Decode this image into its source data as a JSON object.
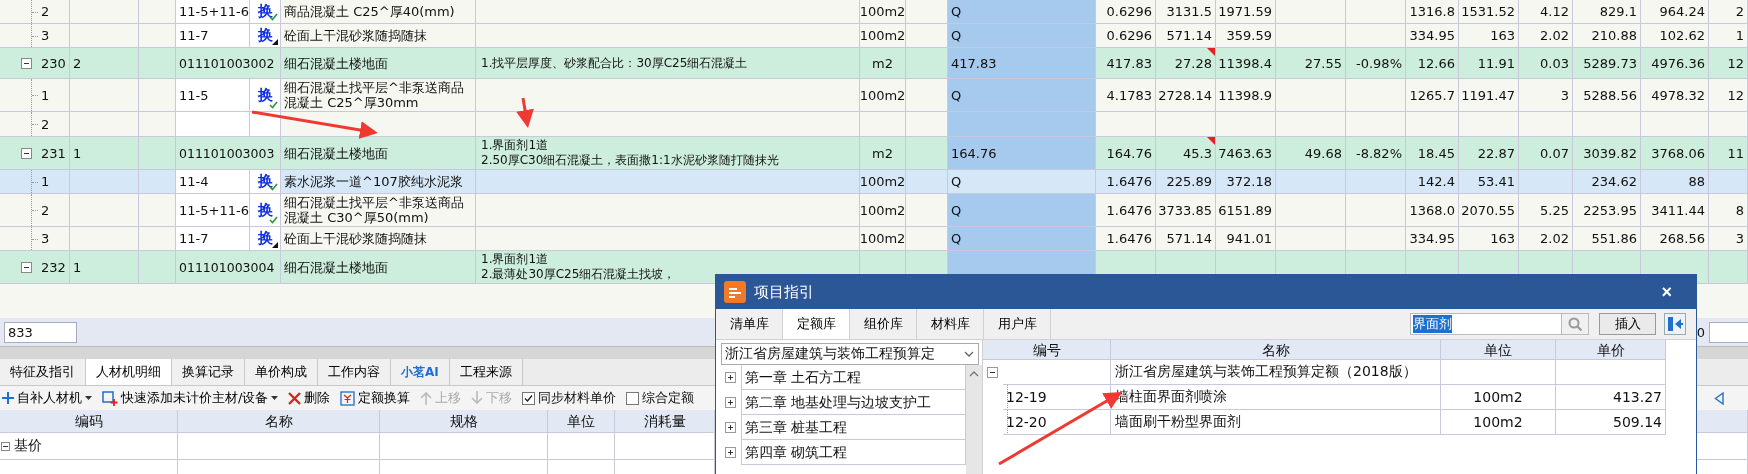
{
  "grid": {
    "rows": [
      {
        "kind": "quota",
        "selected": false,
        "seq": "2",
        "code": "11-5+11-6",
        "badge": "换",
        "badge_checked": true,
        "name": "商品混凝土 C25^厚40(mm)",
        "unit": "100m2",
        "quantity": "Q",
        "values": {
          "v1": "0.6296",
          "v2": "3131.5",
          "v3": "1971.59",
          "v6": "1316.8",
          "v7": "1531.52",
          "v8": "4.12",
          "v9": "829.1",
          "v10": "964.24",
          "v11": "2"
        }
      },
      {
        "kind": "quota",
        "selected": false,
        "seq": "3",
        "code": "11-7",
        "badge": "换",
        "badge_checked": false,
        "name": "砼面上干混砂浆随捣随抹",
        "unit": "100m2",
        "quantity": "Q",
        "values": {
          "v1": "0.6296",
          "v2": "571.14",
          "v3": "359.59",
          "v6": "334.95",
          "v7": "163",
          "v8": "2.02",
          "v9": "210.88",
          "v10": "102.62",
          "v11": "1"
        }
      },
      {
        "kind": "list",
        "selected": false,
        "expanded": true,
        "flagged": true,
        "seq": "230",
        "no": "2",
        "code": "011101003002",
        "name": "细石混凝土楼地面",
        "feature": [
          "1.找平层厚度、砂浆配合比：30厚C25细石混凝土"
        ],
        "unit": "m2",
        "quantity": "417.83",
        "values": {
          "v1": "417.83",
          "v2": "27.28",
          "v3": "11398.4",
          "v4": "27.55",
          "v5": "-0.98%",
          "v6": "12.66",
          "v7": "11.91",
          "v8": "0.03",
          "v9": "5289.73",
          "v10": "4976.36",
          "v11": "12"
        }
      },
      {
        "kind": "quota",
        "selected": false,
        "seq": "1",
        "code": "11-5",
        "badge": "换",
        "badge_checked": true,
        "name": "细石混凝土找平层^非泵送商品混凝土 C25^厚30mm",
        "unit": "100m2",
        "quantity": "Q",
        "values": {
          "v1": "4.1783",
          "v2": "2728.14",
          "v3": "11398.9",
          "v6": "1265.7",
          "v7": "1191.47",
          "v8": "3",
          "v9": "5288.56",
          "v10": "4978.32",
          "v11": "12"
        }
      },
      {
        "kind": "empty",
        "selected": false,
        "seq": "2"
      },
      {
        "kind": "list",
        "selected": false,
        "expanded": true,
        "flagged": true,
        "seq": "231",
        "no": "1",
        "code": "011101003003",
        "name": "细石混凝土楼地面",
        "feature": [
          "1.界面剂1道",
          "2.50厚C30细石混凝土，表面撒1:1水泥砂浆随打随抹光"
        ],
        "unit": "m2",
        "quantity": "164.76",
        "values": {
          "v1": "164.76",
          "v2": "45.3",
          "v3": "7463.63",
          "v4": "49.68",
          "v5": "-8.82%",
          "v6": "18.45",
          "v7": "22.87",
          "v8": "0.07",
          "v9": "3039.82",
          "v10": "3768.06",
          "v11": "11"
        }
      },
      {
        "kind": "quota",
        "selected": true,
        "seq": "1",
        "code": "11-4",
        "badge": "换",
        "badge_checked": true,
        "name": "素水泥浆一道^107胶纯水泥浆",
        "unit": "100m2",
        "quantity": "Q",
        "values": {
          "v1": "1.6476",
          "v2": "225.89",
          "v3": "372.18",
          "v6": "142.4",
          "v7": "53.41",
          "v9": "234.62",
          "v10": "88"
        }
      },
      {
        "kind": "quota",
        "selected": false,
        "seq": "2",
        "code": "11-5+11-6",
        "badge": "换",
        "badge_checked": true,
        "name": "细石混凝土找平层^非泵送商品混凝土 C30^厚50(mm)",
        "unit": "100m2",
        "quantity": "Q",
        "values": {
          "v1": "1.6476",
          "v2": "3733.85",
          "v3": "6151.89",
          "v6": "1368.0",
          "v7": "2070.55",
          "v8": "5.25",
          "v9": "2253.95",
          "v10": "3411.44",
          "v11": "8"
        }
      },
      {
        "kind": "quota",
        "selected": false,
        "seq": "3",
        "code": "11-7",
        "badge": "换",
        "badge_checked": false,
        "name": "砼面上干混砂浆随捣随抹",
        "unit": "100m2",
        "quantity": "Q",
        "values": {
          "v1": "1.6476",
          "v2": "571.14",
          "v3": "941.01",
          "v6": "334.95",
          "v7": "163",
          "v8": "2.02",
          "v9": "551.86",
          "v10": "268.56",
          "v11": "3"
        }
      },
      {
        "kind": "list",
        "selected": false,
        "expanded": true,
        "seq": "232",
        "no": "1",
        "code": "011101003004",
        "name": "细石混凝土楼地面",
        "feature": [
          "1.界面剂1道",
          "2.最薄处30厚C25细石混凝土找坡，"
        ]
      }
    ]
  },
  "status_bar": {
    "left_value": "833",
    "right_label": "0"
  },
  "detail_panel": {
    "tabs": [
      {
        "label": "特征及指引",
        "selected": false,
        "accent": false
      },
      {
        "label": "人材机明细",
        "selected": true,
        "accent": false
      },
      {
        "label": "换算记录",
        "selected": false,
        "accent": false
      },
      {
        "label": "单价构成",
        "selected": false,
        "accent": false
      },
      {
        "label": "工作内容",
        "selected": false,
        "accent": false
      },
      {
        "label": "小茗AI",
        "selected": false,
        "accent": true
      },
      {
        "label": "工程来源",
        "selected": false,
        "accent": false
      }
    ],
    "toolbar": [
      {
        "kind": "add",
        "label": "自补人材机",
        "dropdown": true
      },
      {
        "kind": "add-material",
        "label": "快速添加未计价主材/设备",
        "dropdown": true
      },
      {
        "kind": "delete",
        "label": "删除"
      },
      {
        "kind": "convert",
        "label": "定额换算"
      },
      {
        "kind": "up",
        "label": "上移",
        "disabled": true
      },
      {
        "kind": "down",
        "label": "下移",
        "disabled": true
      },
      {
        "kind": "checkbox",
        "label": "同步材料单价",
        "checked": true
      },
      {
        "kind": "checkbox",
        "label": "综合定额",
        "checked": false
      }
    ],
    "columns": [
      "编码",
      "名称",
      "规格",
      "单位",
      "消耗量"
    ],
    "rows": [
      {
        "label": "基价",
        "expanded": true
      }
    ]
  },
  "dialog": {
    "title": "项目指引",
    "close": "×",
    "tabs": [
      {
        "label": "清单库",
        "selected": false
      },
      {
        "label": "定额库",
        "selected": true
      },
      {
        "label": "组价库",
        "selected": false
      },
      {
        "label": "材料库",
        "selected": false
      },
      {
        "label": "用户库",
        "selected": false
      }
    ],
    "search": {
      "value": "界面剂"
    },
    "insert_button": "插入",
    "library": "浙江省房屋建筑与装饰工程预算定",
    "chapters": [
      {
        "label": "第一章  土石方工程",
        "expanded": false
      },
      {
        "label": "第二章  地基处理与边坡支护工",
        "expanded": false
      },
      {
        "label": "第三章  桩基工程",
        "expanded": false
      },
      {
        "label": "第四章  砌筑工程",
        "expanded": false
      }
    ],
    "table": {
      "columns": [
        "编号",
        "名称",
        "单位",
        "单价"
      ],
      "rows": [
        {
          "kind": "group",
          "expanded": true,
          "name": "浙江省房屋建筑与装饰工程预算定额（2018版）"
        },
        {
          "kind": "item",
          "code": "12-19",
          "name": "墙柱面界面剂喷涂",
          "unit": "100m2",
          "price": "413.27"
        },
        {
          "kind": "item",
          "code": "12-20",
          "name": "墙面刷干粉型界面剂",
          "unit": "100m2",
          "price": "509.14"
        }
      ]
    }
  }
}
